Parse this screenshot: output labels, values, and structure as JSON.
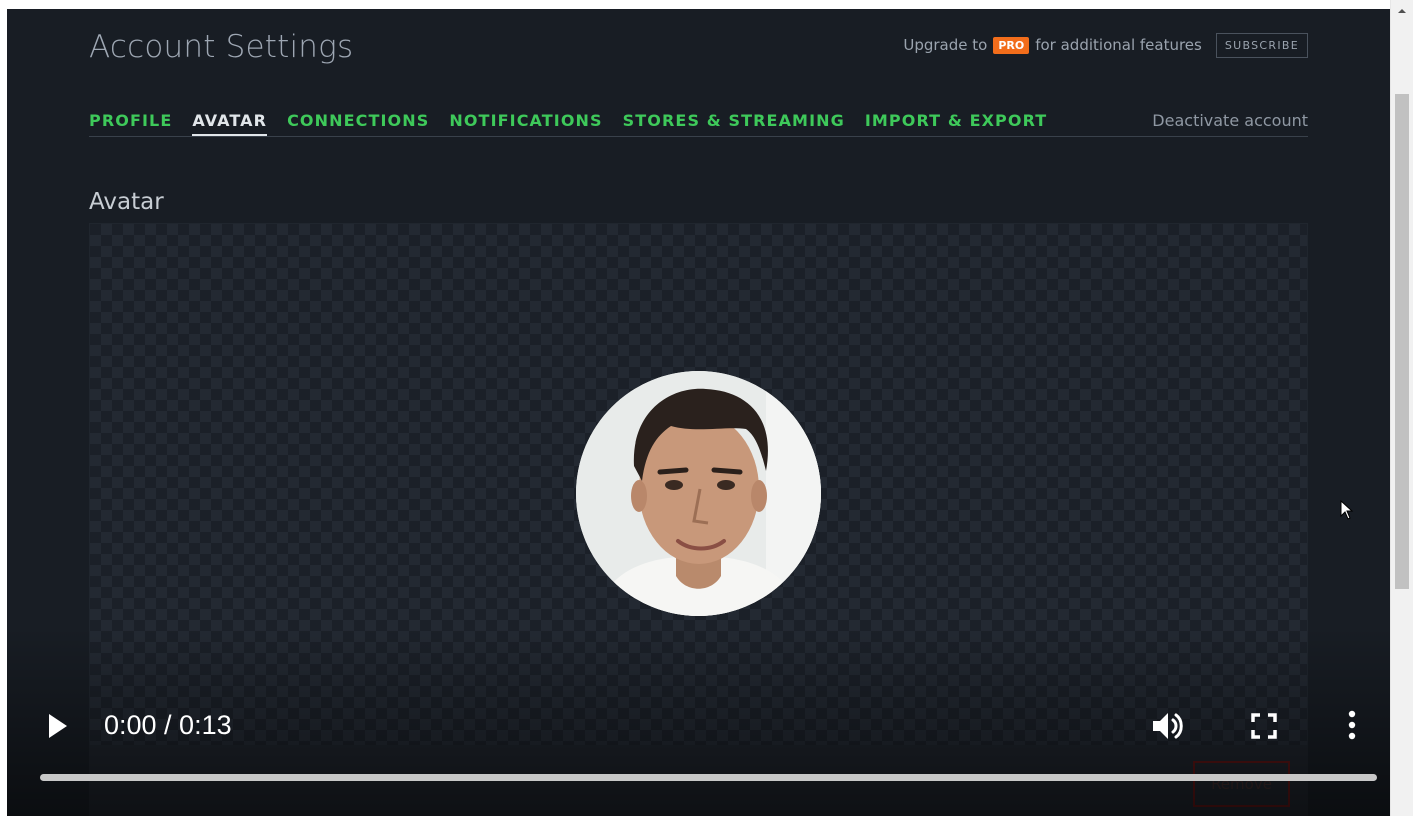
{
  "header": {
    "title": "Account Settings",
    "upgrade_prefix": "Upgrade to",
    "pro_badge": "PRO",
    "upgrade_suffix": "for additional features",
    "subscribe_label": "SUBSCRIBE"
  },
  "tabs": [
    {
      "label": "PROFILE",
      "active": false
    },
    {
      "label": "AVATAR",
      "active": true
    },
    {
      "label": "CONNECTIONS",
      "active": false
    },
    {
      "label": "NOTIFICATIONS",
      "active": false
    },
    {
      "label": "STORES & STREAMING",
      "active": false
    },
    {
      "label": "IMPORT & EXPORT",
      "active": false
    }
  ],
  "deactivate_label": "Deactivate account",
  "section": {
    "heading": "Avatar",
    "remove_label": "Remove"
  },
  "player": {
    "time": "0:00 / 0:13",
    "progress": 0.0,
    "icons": {
      "play": "play-icon",
      "volume": "volume-icon",
      "fullscreen": "fullscreen-icon",
      "more": "more-vertical-icon"
    }
  },
  "colors": {
    "accent_green": "#3ec95a",
    "pro_orange": "#f26d1b",
    "background": "#181d24"
  }
}
